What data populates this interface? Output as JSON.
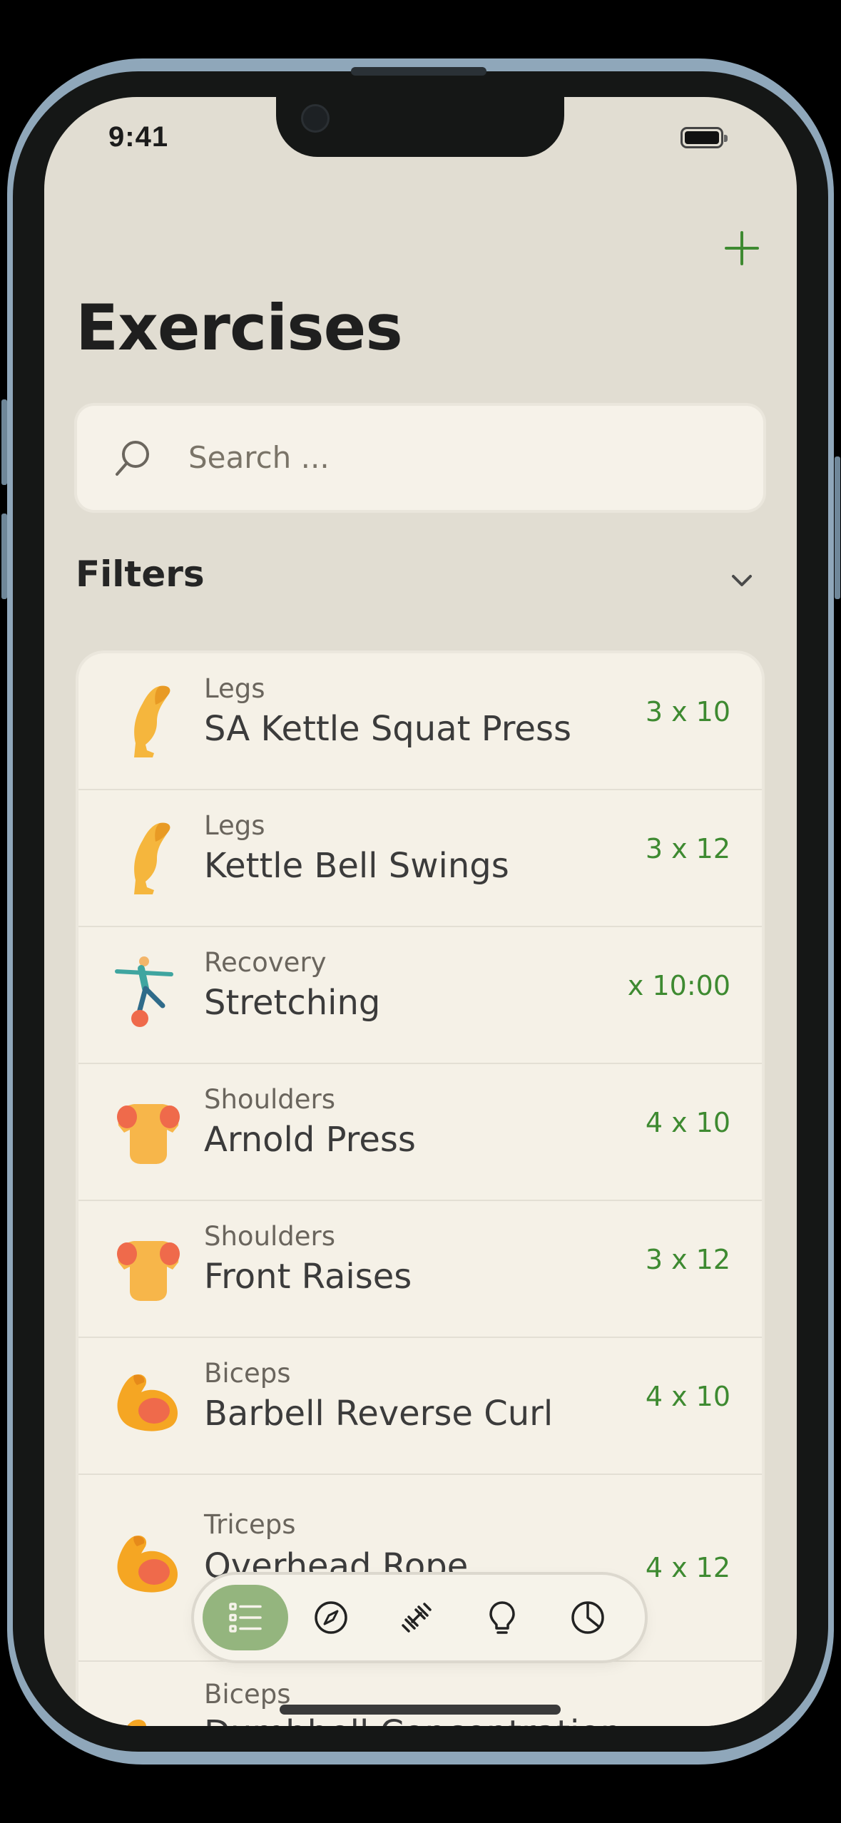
{
  "status": {
    "time": "9:41"
  },
  "header": {
    "title": "Exercises",
    "add_icon": "plus-icon"
  },
  "search": {
    "placeholder": "Search ...",
    "icon": "search-icon"
  },
  "filters": {
    "label": "Filters",
    "icon": "chevron-down-icon"
  },
  "exercises": [
    {
      "category": "Legs",
      "name": "SA Kettle Squat Press",
      "sets": "3 x 10",
      "icon": "leg-icon"
    },
    {
      "category": "Legs",
      "name": "Kettle Bell Swings",
      "sets": "3 x 12",
      "icon": "leg-icon"
    },
    {
      "category": "Recovery",
      "name": "Stretching",
      "sets": "x 10:00",
      "icon": "stretching-person-icon"
    },
    {
      "category": "Shoulders",
      "name": "Arnold Press",
      "sets": "4 x 10",
      "icon": "shoulders-icon"
    },
    {
      "category": "Shoulders",
      "name": "Front Raises",
      "sets": "3 x 12",
      "icon": "shoulders-icon"
    },
    {
      "category": "Biceps",
      "name": "Barbell Reverse Curl",
      "sets": "4 x 10",
      "icon": "flexed-biceps-icon"
    },
    {
      "category": "Triceps",
      "name": "Overhead Rope",
      "sets": "4 x 12",
      "icon": "flexed-biceps-icon"
    },
    {
      "category": "Biceps",
      "name": "Dumbbell Concentration",
      "sets": "",
      "icon": "flexed-biceps-icon"
    }
  ],
  "tabbar": {
    "tabs": [
      {
        "name": "list",
        "icon": "list-icon",
        "active": true
      },
      {
        "name": "explore",
        "icon": "compass-icon",
        "active": false
      },
      {
        "name": "workouts",
        "icon": "dumbbell-icon",
        "active": false
      },
      {
        "name": "tips",
        "icon": "lightbulb-icon",
        "active": false
      },
      {
        "name": "stats",
        "icon": "pie-chart-icon",
        "active": false
      }
    ]
  },
  "colors": {
    "accent": "#3e8a31",
    "background": "#e1ddd2",
    "card": "#f5f1e7",
    "active_tab": "#94b57e"
  }
}
